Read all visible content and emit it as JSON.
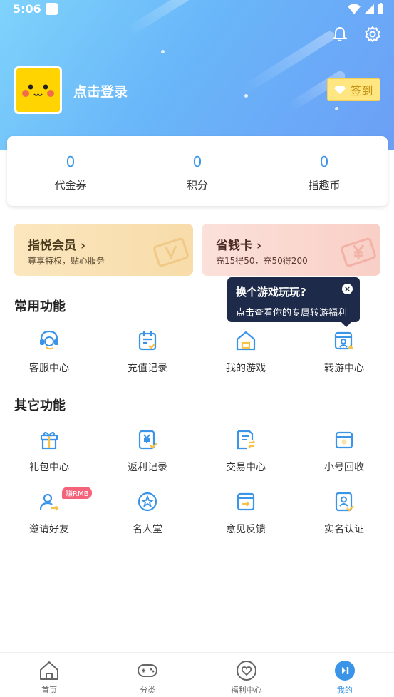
{
  "status_bar": {
    "time": "5:06"
  },
  "profile": {
    "login_text": "点击登录",
    "signin_label": "签到"
  },
  "stats": [
    {
      "value": "0",
      "label": "代金券"
    },
    {
      "value": "0",
      "label": "积分"
    },
    {
      "value": "0",
      "label": "指趣币"
    }
  ],
  "promos": {
    "vip": {
      "title": "指悦会员",
      "subtitle": "尊享特权，贴心服务"
    },
    "card": {
      "title": "省钱卡",
      "subtitle": "充15得50，充50得200"
    }
  },
  "common": {
    "title": "常用功能",
    "items": [
      {
        "label": "客服中心",
        "icon": "headset-icon"
      },
      {
        "label": "充值记录",
        "icon": "calendar-check-icon"
      },
      {
        "label": "我的游戏",
        "icon": "home-game-icon"
      },
      {
        "label": "转游中心",
        "icon": "transfer-icon"
      }
    ]
  },
  "tooltip": {
    "title": "换个游戏玩玩?",
    "body": "点击查看你的专属转游福利"
  },
  "other": {
    "title": "其它功能",
    "items": [
      {
        "label": "礼包中心",
        "icon": "gift-icon"
      },
      {
        "label": "返利记录",
        "icon": "rebate-icon"
      },
      {
        "label": "交易中心",
        "icon": "trade-icon"
      },
      {
        "label": "小号回收",
        "icon": "recycle-icon"
      },
      {
        "label": "邀请好友",
        "icon": "invite-icon"
      },
      {
        "label": "名人堂",
        "icon": "star-icon"
      },
      {
        "label": "意见反馈",
        "icon": "feedback-icon"
      },
      {
        "label": "实名认证",
        "icon": "id-card-icon"
      }
    ],
    "invite_badge": "赚RMB"
  },
  "tabs": [
    {
      "label": "首页",
      "icon": "home-icon"
    },
    {
      "label": "分类",
      "icon": "gamepad-icon"
    },
    {
      "label": "福利中心",
      "icon": "heart-icon"
    },
    {
      "label": "我的",
      "icon": "play-icon",
      "active": true
    }
  ],
  "colors": {
    "accent": "#3a94e8",
    "header_start": "#7fd3fb",
    "header_end": "#6c9ff6",
    "tooltip_bg": "#1d2a4a"
  }
}
